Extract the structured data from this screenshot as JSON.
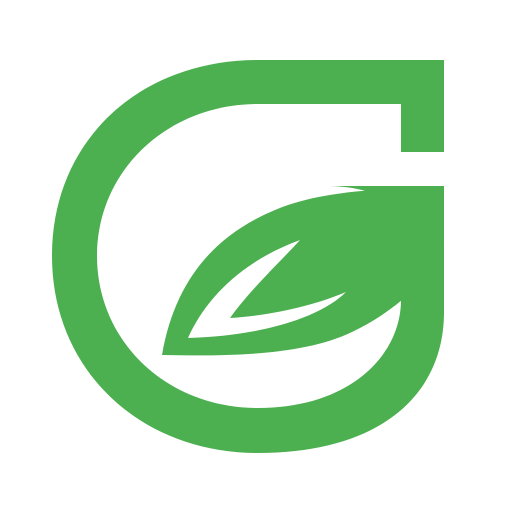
{
  "logo": {
    "icon": "leaf-g-logo-icon",
    "color": "#4CAF50",
    "background": "#ffffff"
  }
}
